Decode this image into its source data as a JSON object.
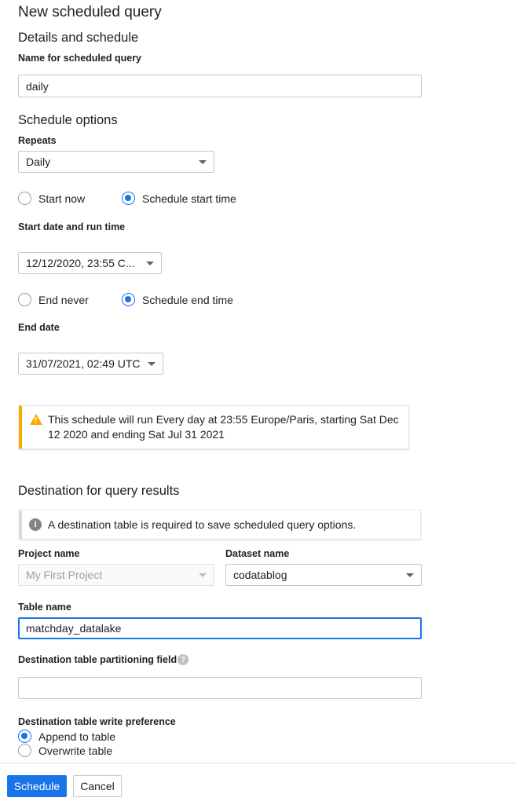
{
  "page": {
    "title": "New scheduled query",
    "details_heading": "Details and schedule"
  },
  "name_field": {
    "label": "Name for scheduled query",
    "value": "daily"
  },
  "schedule": {
    "heading": "Schedule options",
    "repeats_label": "Repeats",
    "repeats_value": "Daily",
    "start_now_label": "Start now",
    "schedule_start_label": "Schedule start time",
    "start_datetime_label": "Start date and run time",
    "start_datetime_value": "12/12/2020, 23:55 C...",
    "end_never_label": "End never",
    "schedule_end_label": "Schedule end time",
    "end_date_label": "End date",
    "end_date_value": "31/07/2021, 02:49 UTC",
    "warning_text": "This schedule will run Every day at 23:55 Europe/Paris, starting Sat Dec 12 2020 and ending Sat Jul 31 2021"
  },
  "destination": {
    "heading": "Destination for query results",
    "info_text": "A destination table is required to save scheduled query options.",
    "project_label": "Project name",
    "project_value": "My First Project",
    "dataset_label": "Dataset name",
    "dataset_value": "codatablog",
    "table_label": "Table name",
    "table_value": "matchday_datalake",
    "partition_label": "Destination table partitioning field",
    "partition_value": "",
    "write_pref_label": "Destination table write preference",
    "append_label": "Append to table",
    "overwrite_label": "Overwrite table"
  },
  "footer": {
    "schedule_button": "Schedule",
    "cancel_button": "Cancel"
  },
  "colors": {
    "accent": "#1a73e8",
    "warning": "#f9ab00"
  }
}
